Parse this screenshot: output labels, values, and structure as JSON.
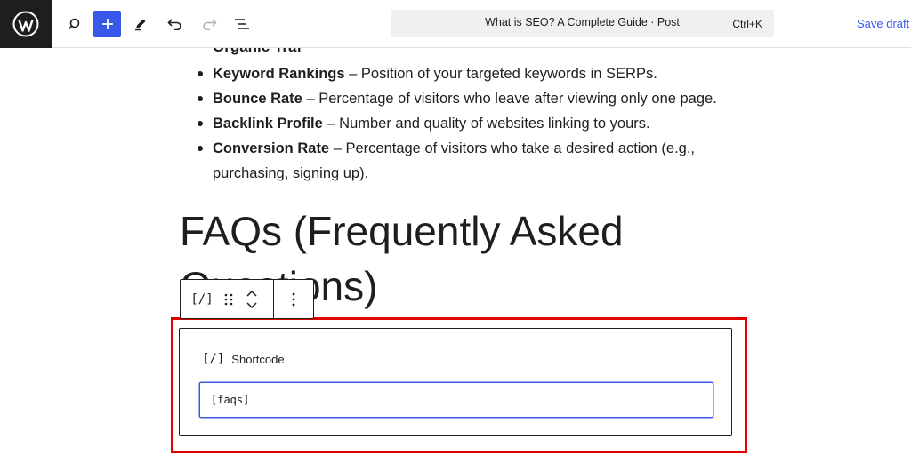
{
  "toolbar": {
    "command_title": "What is SEO? A Complete Guide · Post",
    "command_shortcut": "Ctrl+K",
    "save_label": "Save draft",
    "icons": [
      "wordpress-logo",
      "search-icon",
      "add-block-icon",
      "edit-pen-icon",
      "undo-icon",
      "redo-icon",
      "document-overview-icon"
    ],
    "accent_color": "#3858e9"
  },
  "content": {
    "cut_off_line": "Organic Traf",
    "metrics": [
      {
        "term": "Keyword Rankings",
        "desc": " – Position of your targeted keywords in SERPs."
      },
      {
        "term": "Bounce Rate",
        "desc": " – Percentage of visitors who leave after viewing only one page."
      },
      {
        "term": "Backlink Profile",
        "desc": " – Number and quality of websites linking to yours."
      },
      {
        "term": "Conversion Rate",
        "desc": " – Percentage of visitors who take a desired action (e.g., purchasing, signing up)."
      }
    ],
    "faq_heading": "FAQs (Frequently Asked Questions)"
  },
  "block_toolbar": {
    "block_icon": "[/]",
    "icons": [
      "shortcode-icon",
      "drag-handle-icon",
      "move-up-icon",
      "move-down-icon",
      "more-options-icon"
    ]
  },
  "shortcode_block": {
    "icon": "[/]",
    "label": "Shortcode",
    "value": "[faqs]",
    "highlight_color": "#e00000"
  }
}
